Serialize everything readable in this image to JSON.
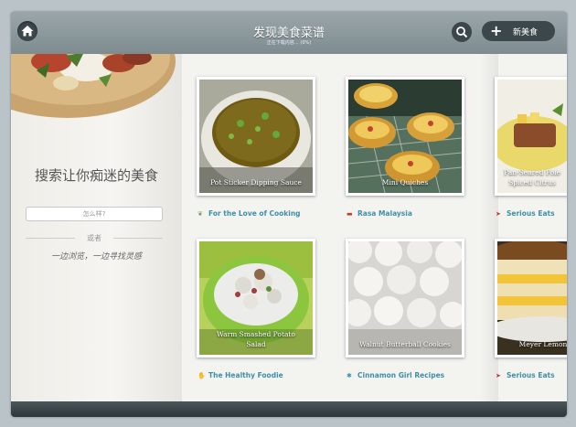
{
  "header": {
    "title": "发现美食菜谱",
    "subtitle": "正在下载内容… (0%)",
    "new_button_label": "新美食"
  },
  "sidebar": {
    "heading": "搜索让你痴迷的美食",
    "search_placeholder": "怎么样?",
    "or_label": "或者",
    "tagline": "一边浏览，一边寻找灵感"
  },
  "recipes": [
    {
      "title": "Pot Sticker Dipping Sauce",
      "source": "For the Love of Cooking",
      "source_icon": "leaf-icon"
    },
    {
      "title": "Mini Quiches",
      "source": "Rasa Malaysia",
      "source_icon": "flag-icon"
    },
    {
      "title": "Pan-Seared Foie Gras, Spiced Citrus",
      "title_line1": "Pan-Seared Foie",
      "title_line2": "Spiced Citrus",
      "source": "Serious Eats",
      "source_icon": "chili-icon"
    },
    {
      "title": "Warm Smashed Potato Salad",
      "title_line1": "Warm Smashed Potato",
      "title_line2": "Salad",
      "source": "The Healthy Foodie",
      "source_icon": "hand-icon"
    },
    {
      "title": "Walnut Butterball Cookies",
      "source": "Cinnamon Girl Recipes",
      "source_icon": "snowflake-icon"
    },
    {
      "title": "Meyer Lemon",
      "source": "Serious Eats",
      "source_icon": "chili-icon"
    }
  ],
  "colors": {
    "link": "#3f8fa8",
    "topbar": "#8a979b",
    "button": "#3c474b"
  }
}
